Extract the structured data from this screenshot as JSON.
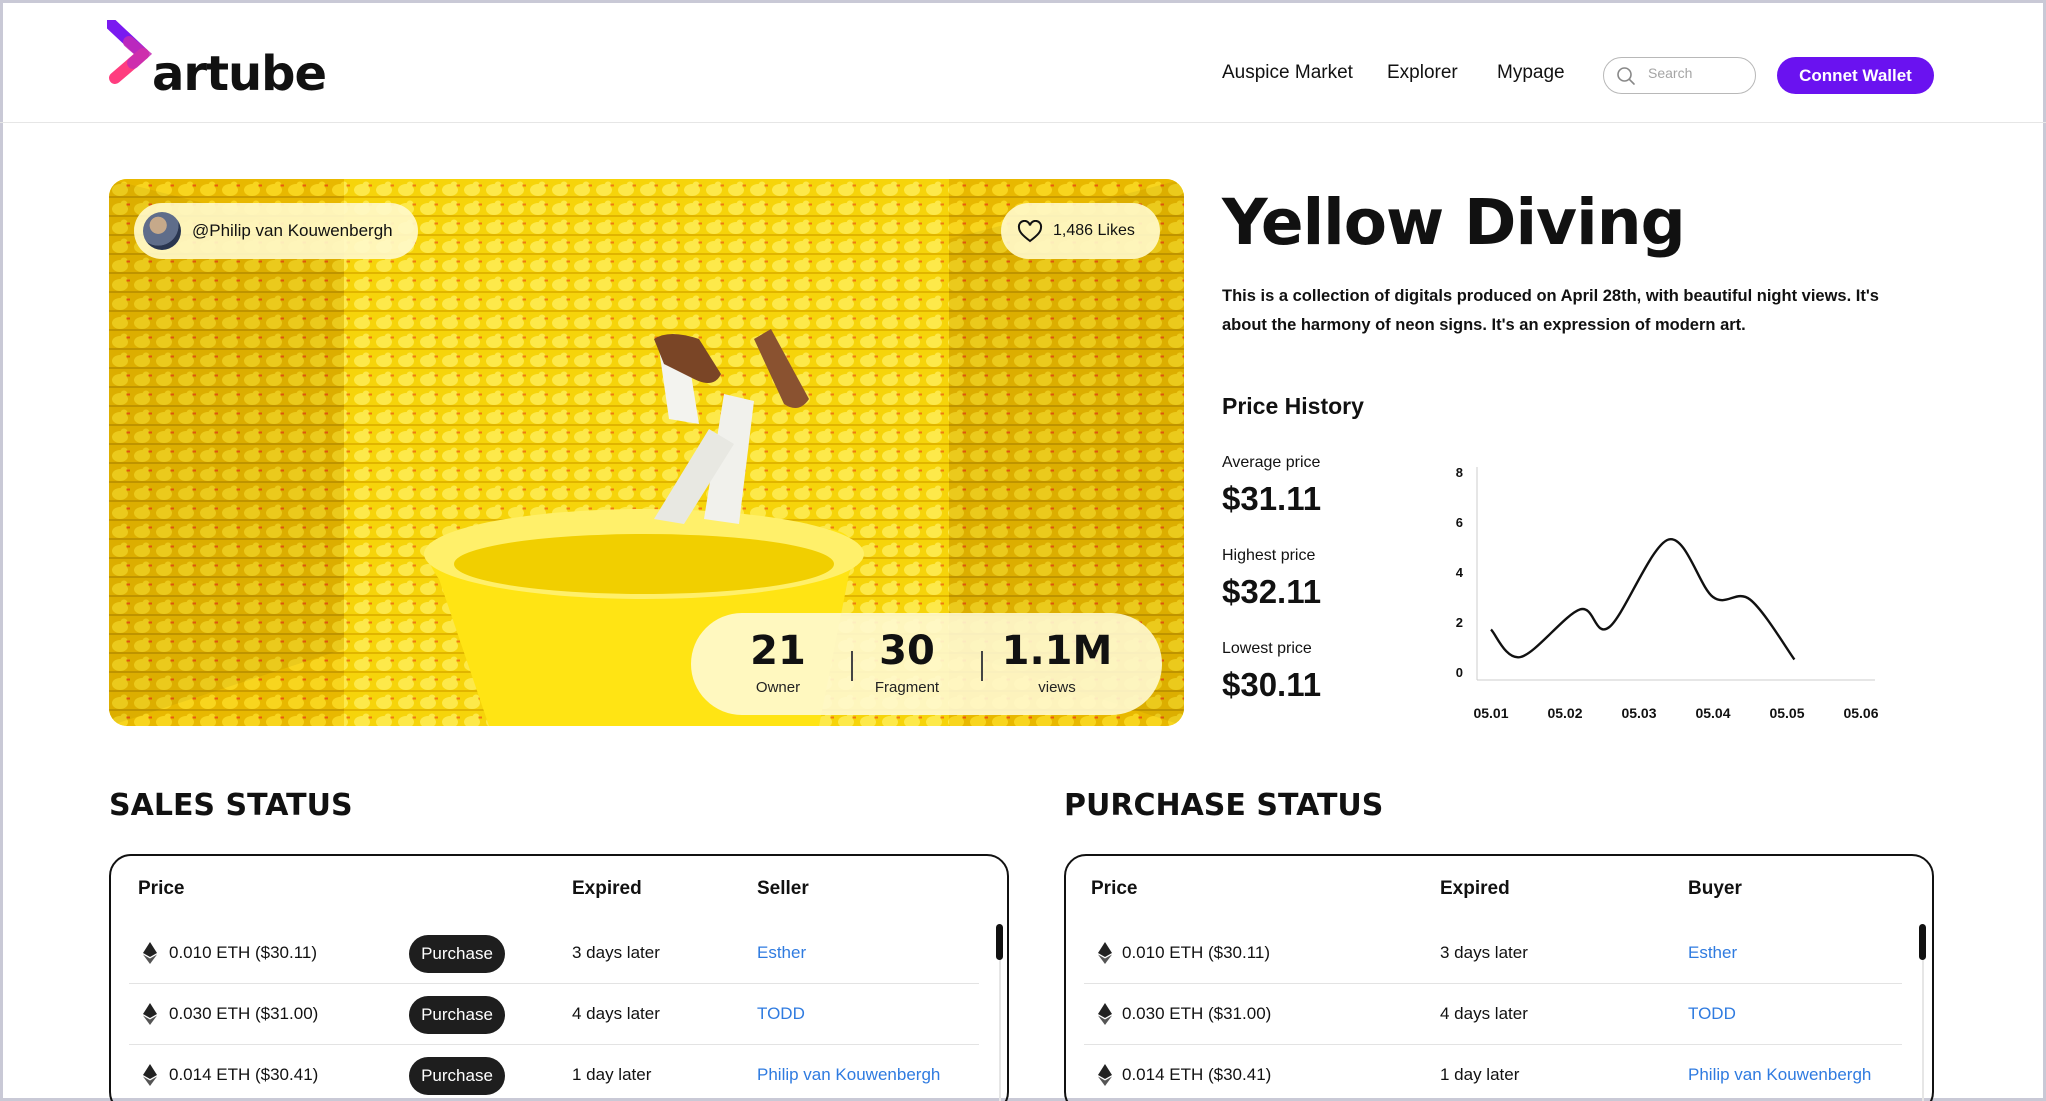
{
  "header": {
    "logo_text": "artube",
    "nav": [
      "Auspice Market",
      "Explorer",
      "Mypage"
    ],
    "search_placeholder": "Search",
    "wallet_label": "Connet Wallet"
  },
  "hero": {
    "creator": "@Philip van Kouwenbergh",
    "likes": "1,486 Likes",
    "stats": [
      {
        "value": "21",
        "label": "Owner"
      },
      {
        "value": "30",
        "label": "Fragment"
      },
      {
        "value": "1.1M",
        "label": "views"
      }
    ]
  },
  "details": {
    "title": "Yellow Diving",
    "description": "This is a collection of digitals produced on April 28th, with beautiful night views. It's about the harmony of neon signs. It's an expression of modern art.",
    "price_history_title": "Price History",
    "prices": [
      {
        "label": "Average price",
        "value": "$31.11"
      },
      {
        "label": "Highest price",
        "value": "$32.11"
      },
      {
        "label": "Lowest price",
        "value": "$30.11"
      }
    ]
  },
  "chart_data": {
    "type": "line",
    "x": [
      "05.01",
      "05.02",
      "05.03",
      "05.04",
      "05.05",
      "05.06"
    ],
    "curve_points": [
      [
        0.0,
        1.7
      ],
      [
        0.4,
        0.6
      ],
      [
        1.2,
        2.5
      ],
      [
        1.6,
        1.8
      ],
      [
        2.4,
        5.3
      ],
      [
        3.0,
        3.0
      ],
      [
        3.5,
        2.9
      ],
      [
        4.1,
        0.5
      ]
    ],
    "yticks": [
      0,
      2,
      4,
      6,
      8
    ],
    "ylim": [
      0,
      8
    ],
    "title": "",
    "xlabel": "",
    "ylabel": "",
    "grid": false,
    "line_color": "#111111"
  },
  "sales": {
    "title": "SALES STATUS",
    "headers": [
      "Price",
      "Expired",
      "Seller"
    ],
    "button_label": "Purchase",
    "rows": [
      {
        "price": "0.010 ETH ($30.11)",
        "expired": "3 days later",
        "party": "Esther"
      },
      {
        "price": "0.030 ETH ($31.00)",
        "expired": "4 days later",
        "party": "TODD"
      },
      {
        "price": "0.014 ETH ($30.41)",
        "expired": "1 day later",
        "party": "Philip van Kouwenbergh"
      }
    ]
  },
  "purchase": {
    "title": "PURCHASE STATUS",
    "headers": [
      "Price",
      "Expired",
      "Buyer"
    ],
    "rows": [
      {
        "price": "0.010 ETH ($30.11)",
        "expired": "3 days later",
        "party": "Esther"
      },
      {
        "price": "0.030 ETH ($31.00)",
        "expired": "4 days later",
        "party": "TODD"
      },
      {
        "price": "0.014 ETH ($30.41)",
        "expired": "1 day later",
        "party": "Philip van Kouwenbergh"
      }
    ]
  },
  "colors": {
    "accent": "#6a12f0",
    "link": "#2f7be0",
    "hero_yellow": "#f7d90c"
  }
}
